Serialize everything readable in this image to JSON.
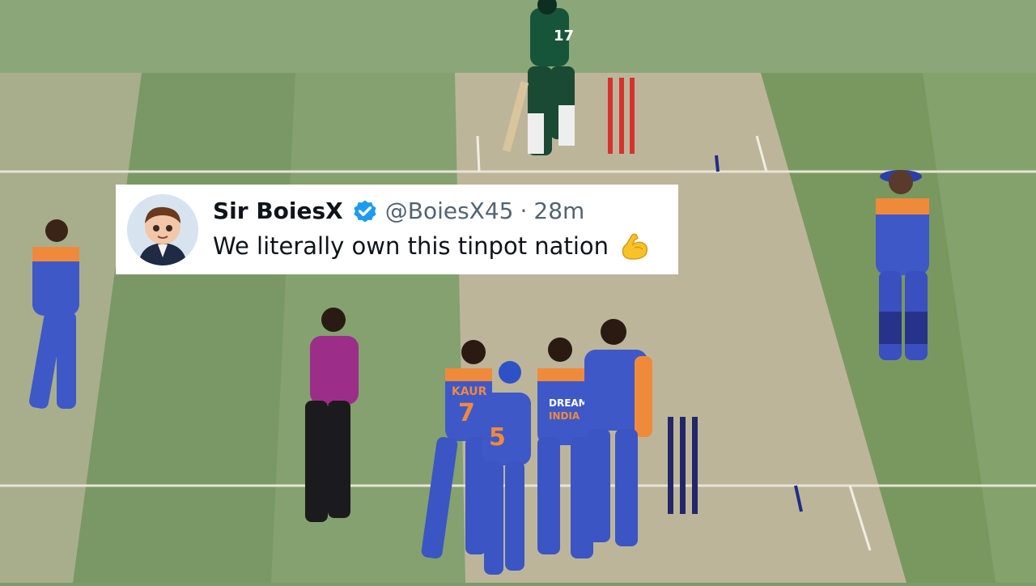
{
  "photo": {
    "subject": "cricket-match"
  },
  "tweet": {
    "display_name": "Sir BoiesX",
    "handle": "@BoiesX45",
    "separator": "·",
    "time": "28m",
    "text": "We literally own this tinpot nation",
    "verified_color": "#1d9bf0",
    "emoji_icon": "flexed-biceps-icon"
  },
  "photo_text": {
    "batter_number": "17",
    "bowler_number": "7",
    "bowler_name": "KAUR",
    "fielder_number": "5",
    "sponsor": "DREAM11",
    "team": "INDIA"
  }
}
